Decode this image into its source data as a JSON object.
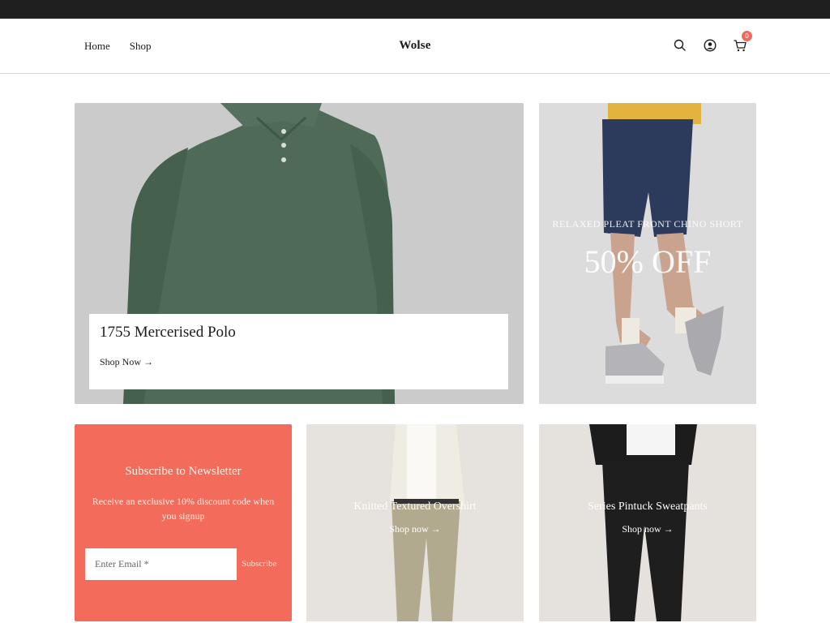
{
  "header": {
    "nav": [
      {
        "label": "Home"
      },
      {
        "label": "Shop"
      }
    ],
    "logo": "Wolse",
    "icons": [
      "search-icon",
      "account-icon",
      "cart-icon"
    ],
    "cart_count": "0"
  },
  "hero": {
    "title": "1755 Mercerised Polo",
    "link": "Shop Now →"
  },
  "promo": {
    "subtitle": "RELAXED PLEAT FRONT CHINO SHORT",
    "headline": "50% OFF"
  },
  "newsletter": {
    "title": "Subscribe to Newsletter",
    "description": "Receive an exclusive 10% discount code when you signup",
    "placeholder": "Enter Email *",
    "button": "Subscribe"
  },
  "products": [
    {
      "title": "Knitted Textured Overshirt",
      "link": "Shop now →"
    },
    {
      "title": "Series Pintuck Sweatpants",
      "link": "Shop now →"
    }
  ],
  "colors": {
    "accent": "#f26b5b",
    "topbar": "#1f1f1f",
    "badge": "#ef6a5b"
  }
}
